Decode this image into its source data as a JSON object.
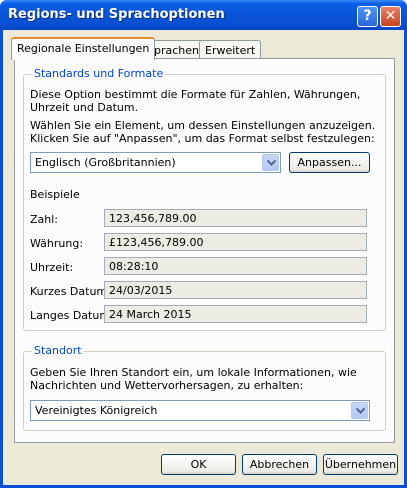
{
  "window": {
    "title": "Regions- und Sprachoptionen",
    "help_glyph": "?",
    "close_glyph": "✕"
  },
  "tabs": [
    {
      "label": "Regionale Einstellungen",
      "active": true
    },
    {
      "label": "Sprachen",
      "active": false
    },
    {
      "label": "Erweitert",
      "active": false
    }
  ],
  "standards": {
    "legend": "Standards und Formate",
    "description": "Diese Option bestimmt die Formate für Zahlen, Währungen, Uhrzeit und Datum.",
    "instruction": "Wählen Sie ein Element, um dessen Einstellungen anzuzeigen. Klicken Sie auf \"Anpassen\", um das Format selbst festzulegen:",
    "format_select": {
      "value": "Englisch (Großbritannien)"
    },
    "customize_button": "Anpassen...",
    "examples_title": "Beispiele",
    "examples": [
      {
        "label": "Zahl:",
        "value": "123,456,789.00"
      },
      {
        "label": "Währung:",
        "value": "£123,456,789.00"
      },
      {
        "label": "Uhrzeit:",
        "value": "08:28:10"
      },
      {
        "label": "Kurzes Datum:",
        "value": "24/03/2015"
      },
      {
        "label": "Langes Datum:",
        "value": "24 March 2015"
      }
    ]
  },
  "location": {
    "legend": "Standort",
    "description": "Geben Sie Ihren Standort ein, um lokale Informationen, wie Nachrichten und Wettervorhersagen, zu erhalten:",
    "location_select": {
      "value": "Vereinigtes Königreich"
    }
  },
  "footer": {
    "ok": "OK",
    "cancel": "Abbrechen",
    "apply": "Übernehmen"
  },
  "colors": {
    "title_bar": "#0a55d8",
    "group_legend": "#0046d5",
    "active_tab_highlight": "#e68b2c",
    "dialog_background": "#ece9d8"
  }
}
